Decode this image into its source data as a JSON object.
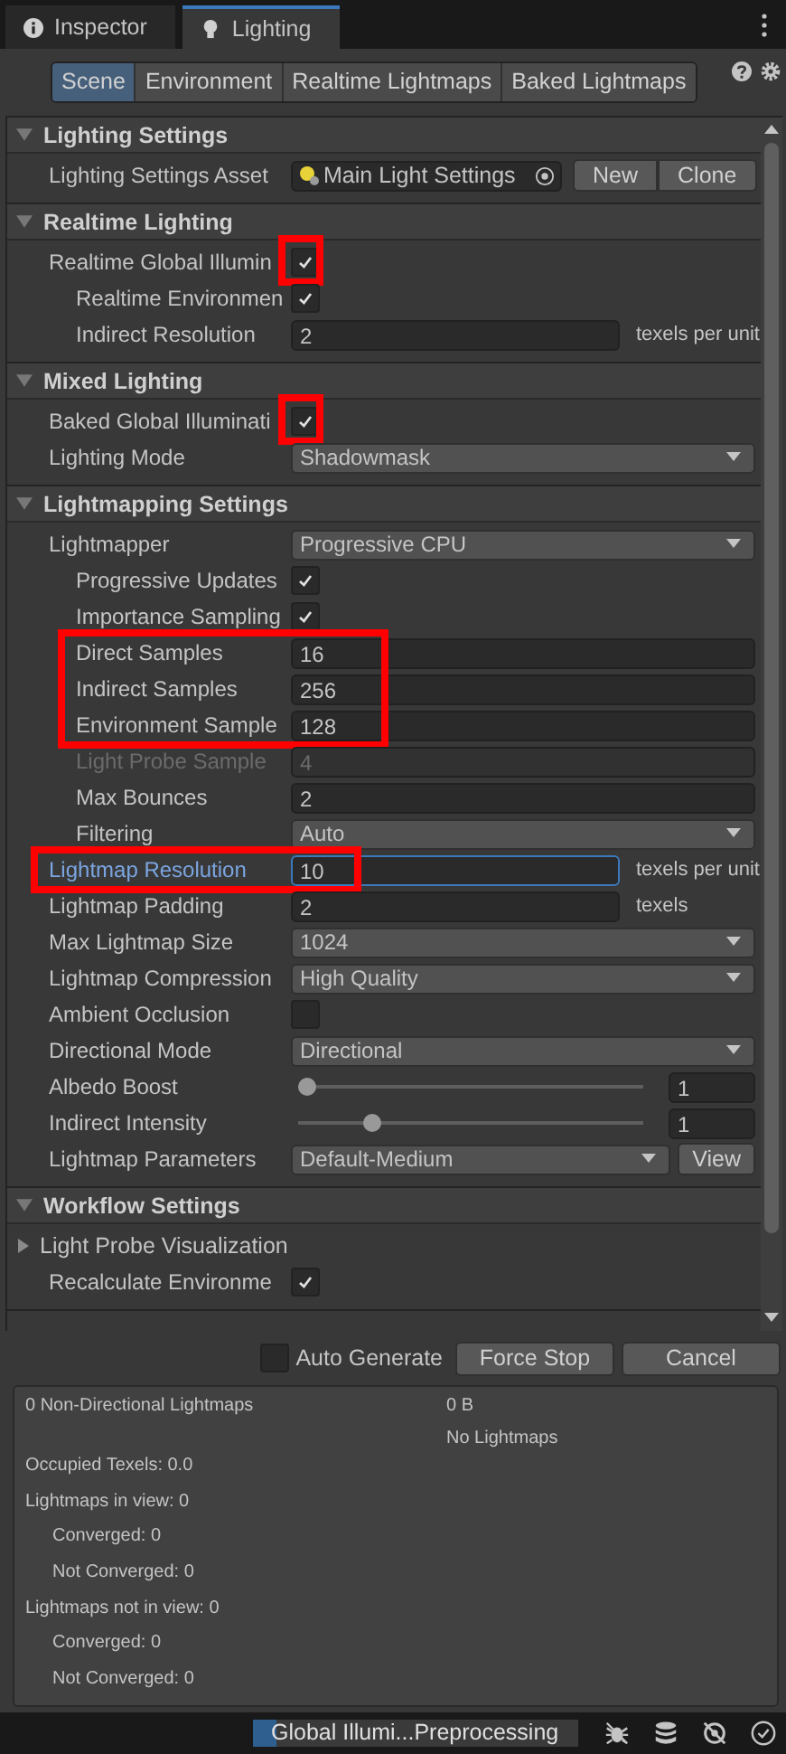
{
  "tabs": [
    {
      "label": "Inspector",
      "selected": false
    },
    {
      "label": "Lighting",
      "selected": true
    }
  ],
  "modes": [
    {
      "label": "Scene",
      "selected": true
    },
    {
      "label": "Environment",
      "selected": false
    },
    {
      "label": "Realtime Lightmaps",
      "selected": false
    },
    {
      "label": "Baked Lightmaps",
      "selected": false
    }
  ],
  "sections": [
    {
      "title": "Lighting Settings",
      "expanded": true,
      "rows": [
        {
          "kind": "object",
          "label": "Lighting Settings Asset",
          "value": "Main Light Settings",
          "buttons": [
            "New",
            "Clone"
          ]
        }
      ]
    },
    {
      "title": "Realtime Lighting",
      "expanded": true,
      "rows": [
        {
          "kind": "checkbox",
          "label": "Realtime Global Illumin",
          "checked": true,
          "highlighted": true,
          "children": [
            {
              "kind": "checkbox",
              "label": "Realtime Environmen",
              "checked": true
            },
            {
              "kind": "number",
              "label": "Indirect Resolution",
              "value": "2",
              "unit": "texels per unit"
            }
          ]
        }
      ]
    },
    {
      "title": "Mixed Lighting",
      "expanded": true,
      "rows": [
        {
          "kind": "checkbox",
          "label": "Baked Global Illuminati",
          "checked": true,
          "highlighted": true
        },
        {
          "kind": "dropdown",
          "label": "Lighting Mode",
          "value": "Shadowmask"
        }
      ]
    },
    {
      "title": "Lightmapping Settings",
      "expanded": true,
      "rows": [
        {
          "kind": "dropdown",
          "label": "Lightmapper",
          "value": "Progressive CPU",
          "children": [
            {
              "kind": "checkbox",
              "label": "Progressive Updates",
              "checked": true
            },
            {
              "kind": "checkbox",
              "label": "Importance Sampling",
              "checked": true
            },
            {
              "kind": "number",
              "label": "Direct Samples",
              "value": "16",
              "highlighted": true
            },
            {
              "kind": "number",
              "label": "Indirect Samples",
              "value": "256",
              "highlighted": true
            },
            {
              "kind": "number",
              "label": "Environment Sample",
              "value": "128",
              "highlighted": true
            },
            {
              "kind": "number",
              "label": "Light Probe Sample",
              "value": "4",
              "disabled": true
            },
            {
              "kind": "number",
              "label": "Max Bounces",
              "value": "2"
            },
            {
              "kind": "dropdown",
              "label": "Filtering",
              "value": "Auto"
            }
          ]
        },
        {
          "kind": "number",
          "label": "Lightmap Resolution",
          "value": "10",
          "unit": "texels per unit",
          "highlighted": true,
          "focused": true
        },
        {
          "kind": "number",
          "label": "Lightmap Padding",
          "value": "2",
          "unit": "texels"
        },
        {
          "kind": "dropdown",
          "label": "Max Lightmap Size",
          "value": "1024"
        },
        {
          "kind": "dropdown",
          "label": "Lightmap Compression",
          "value": "High Quality"
        },
        {
          "kind": "checkbox",
          "label": "Ambient Occlusion",
          "checked": false
        },
        {
          "kind": "dropdown",
          "label": "Directional Mode",
          "value": "Directional"
        },
        {
          "kind": "slider",
          "label": "Albedo Boost",
          "level": 0,
          "value": "1"
        },
        {
          "kind": "slider",
          "label": "Indirect Intensity",
          "level": 0.2,
          "value": "1"
        },
        {
          "kind": "dropdown",
          "label": "Lightmap Parameters",
          "value": "Default-Medium",
          "button": "View"
        }
      ]
    },
    {
      "title": "Workflow Settings",
      "expanded": true,
      "rows": [
        {
          "kind": "foldout",
          "label": "Light Probe Visualization",
          "expanded": false
        },
        {
          "kind": "checkbox",
          "label": "Recalculate Environme",
          "checked": true
        }
      ]
    }
  ],
  "bake": {
    "auto_generate": {
      "label": "Auto Generate",
      "checked": false
    },
    "buttons": [
      "Force Stop",
      "Cancel"
    ]
  },
  "stats": {
    "summary": "0 Non-Directional Lightmaps",
    "size": "0 B",
    "status": "No Lightmaps",
    "lines": [
      {
        "text": "Occupied Texels: 0.0"
      },
      {
        "text": "Lightmaps in view: 0",
        "children": [
          {
            "text": "Converged: 0"
          },
          {
            "text": "Not Converged: 0"
          }
        ]
      },
      {
        "text": "Lightmaps not in view: 0",
        "children": [
          {
            "text": "Converged: 0"
          },
          {
            "text": "Not Converged: 0"
          }
        ]
      }
    ]
  },
  "status_bar": {
    "progress": {
      "label": "Global Illumi...Preprocessing",
      "level": 0.07
    }
  }
}
